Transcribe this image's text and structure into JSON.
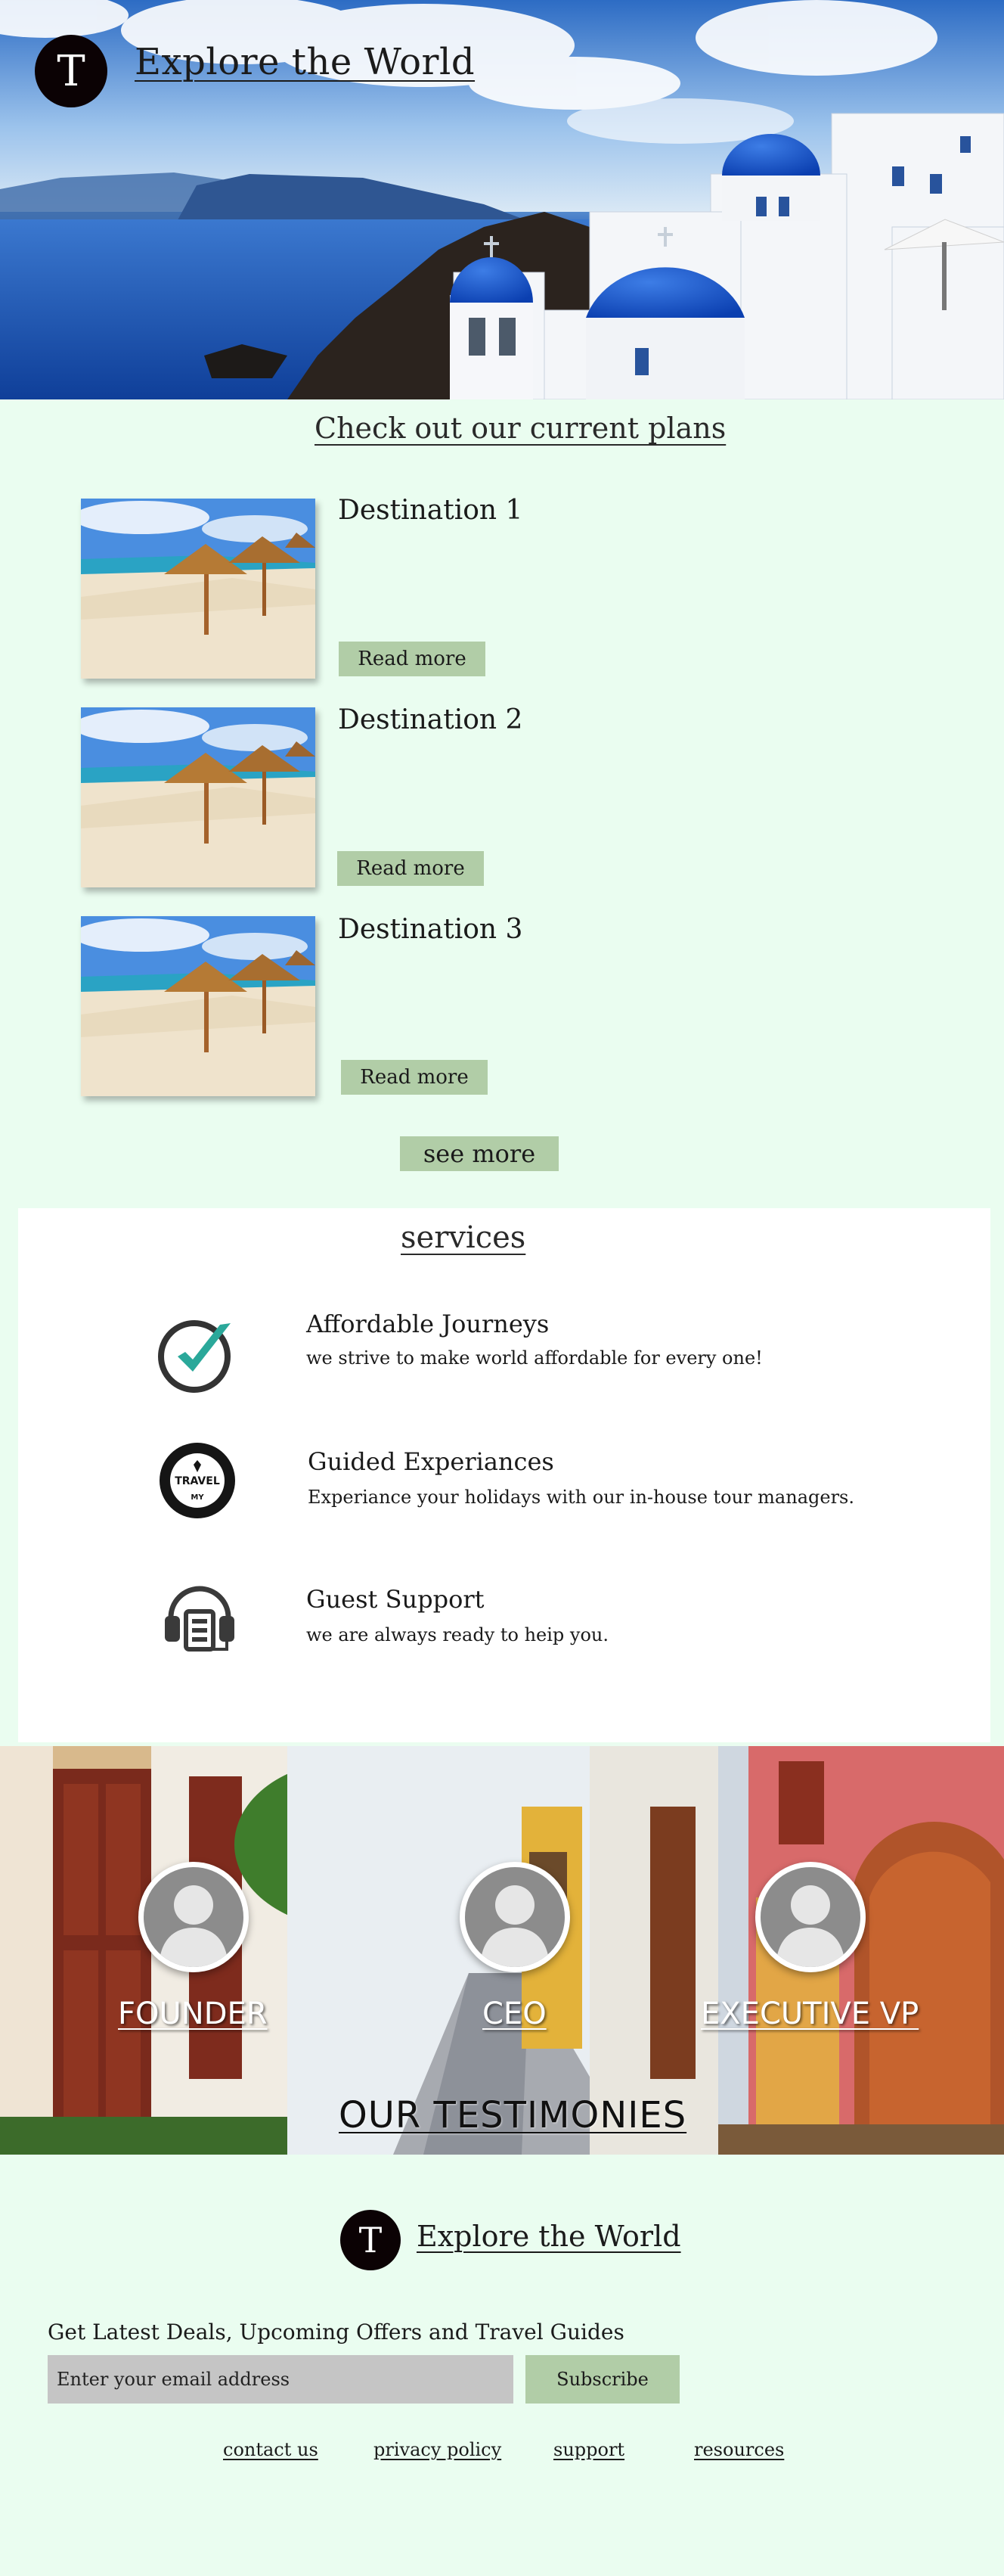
{
  "header": {
    "logo_letter": "T",
    "title": "Explore the World"
  },
  "plans": {
    "heading": "Check out our current plans",
    "destinations": [
      {
        "title": "Destination 1",
        "button": "Read more"
      },
      {
        "title": "Destination 2",
        "button": "Read more"
      },
      {
        "title": "Destination 3",
        "button": "Read more"
      }
    ],
    "see_more": "see more"
  },
  "services": {
    "heading": "services",
    "items": [
      {
        "title": "Affordable  Journeys",
        "description": "we strive to make world affordable for   every one!",
        "icon": "checkmark-icon"
      },
      {
        "title": "Guided Experiances",
        "description": "Experiance your holidays with our in-house tour managers.",
        "icon": "travel-badge-icon"
      },
      {
        "title": "Guest Support",
        "description": "we are always ready to heip you.",
        "icon": "headset-icon"
      }
    ],
    "badge_text": "TRAVEL",
    "badge_subtext": "MY"
  },
  "testimonies": {
    "heading": "OUR   TESTIMONIES",
    "people": [
      {
        "role": "FOUNDER"
      },
      {
        "role": "CEO"
      },
      {
        "role": "EXECUTIVE VP"
      }
    ]
  },
  "footer": {
    "logo_letter": "T",
    "title": "Explore the World",
    "newsletter_label": "Get Latest Deals, Upcoming Offers and Travel Guides",
    "email_placeholder": "Enter your email address",
    "subscribe": "Subscribe",
    "links": [
      "contact us",
      "privacy policy",
      "support",
      "resources"
    ]
  },
  "colors": {
    "page_bg": "#eafdf0",
    "button_green": "#b1cda7",
    "logo_black": "#0b0204"
  }
}
